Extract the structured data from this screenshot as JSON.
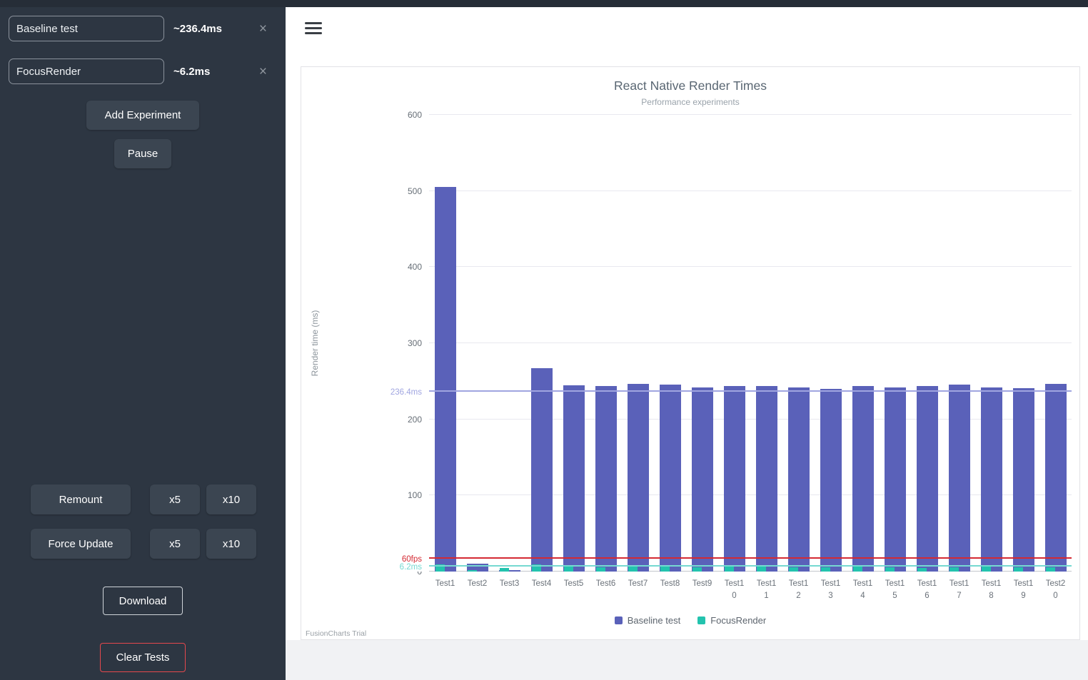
{
  "sidebar": {
    "experiments": [
      {
        "name": "Baseline test",
        "avg": "~236.4ms",
        "remove_label": "×"
      },
      {
        "name": "FocusRender",
        "avg": "~6.2ms",
        "remove_label": "×"
      }
    ],
    "buttons": {
      "add_experiment": "Add Experiment",
      "pause": "Pause",
      "remount": "Remount",
      "remount_x5": "x5",
      "remount_x10": "x10",
      "force_update": "Force Update",
      "force_x5": "x5",
      "force_x10": "x10",
      "download": "Download",
      "clear_tests": "Clear Tests"
    }
  },
  "chart_data": {
    "type": "bar",
    "title": "React Native Render Times",
    "subtitle": "Performance experiments",
    "ylabel": "Render time (ms)",
    "xlabel": "",
    "ylim": [
      0,
      600
    ],
    "yticks": [
      0,
      100,
      200,
      300,
      400,
      500,
      600
    ],
    "grid": true,
    "legend_position": "bottom",
    "categories": [
      "Test1",
      "Test2",
      "Test3",
      "Test4",
      "Test5",
      "Test6",
      "Test7",
      "Test8",
      "Test9",
      "Test10",
      "Test11",
      "Test12",
      "Test13",
      "Test14",
      "Test15",
      "Test16",
      "Test17",
      "Test18",
      "Test19",
      "Test20"
    ],
    "series": [
      {
        "name": "Baseline test",
        "color": "#5a61b9",
        "values": [
          505,
          10,
          2,
          267,
          245,
          244,
          247,
          246,
          242,
          244,
          244,
          242,
          240,
          244,
          242,
          244,
          246,
          242,
          241,
          247
        ]
      },
      {
        "name": "FocusRender",
        "color": "#23c3ae",
        "values": [
          9,
          2,
          5,
          9,
          7,
          6,
          7,
          7,
          6,
          7,
          7,
          6,
          6,
          7,
          6,
          5,
          6,
          7,
          6,
          6
        ]
      }
    ],
    "trendlines": [
      {
        "label": "236.4ms",
        "value": 236.4,
        "color": "#a0a5e0"
      },
      {
        "label": "60fps",
        "value": 16.7,
        "color": "#d42a33"
      },
      {
        "label": "6.2ms",
        "value": 6.2,
        "color": "#76d9d1"
      }
    ],
    "watermark": "FusionCharts Trial"
  }
}
